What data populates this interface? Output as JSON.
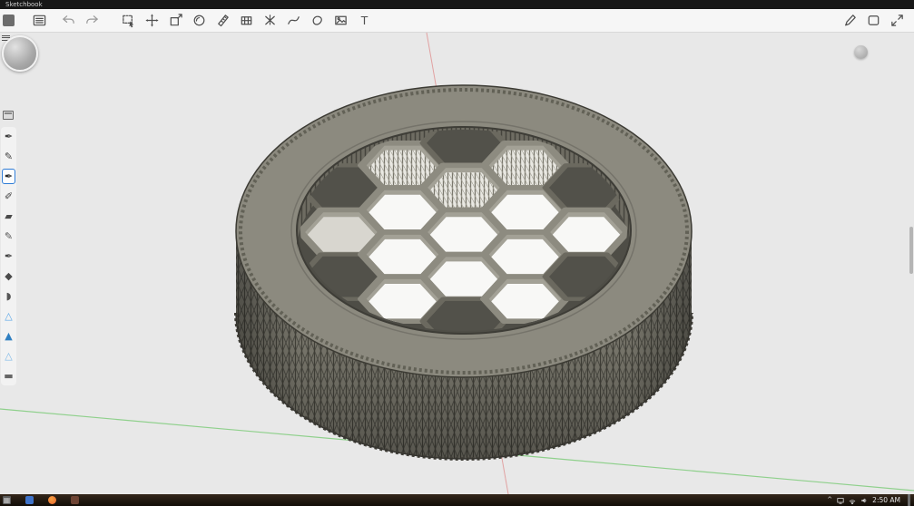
{
  "window": {
    "title": "Sketchbook"
  },
  "toolbar": {
    "left_icons": [
      "app-menu",
      "menu-list",
      "undo",
      "redo",
      "marquee-select",
      "move-transform",
      "distort",
      "fill-circle",
      "ruler",
      "perspective-grid",
      "symmetry",
      "stroke-curve",
      "lasso-shape",
      "import-image",
      "text-tool"
    ],
    "right_icons": [
      "stylus-edit",
      "layer-panel",
      "fullscreen"
    ],
    "text_glyph": "T"
  },
  "brushes": {
    "selected_index": 2,
    "items": [
      {
        "name": "ink-bottle",
        "glyph": "✒",
        "color": "#3f3f3f"
      },
      {
        "name": "pencil",
        "glyph": "✎",
        "color": "#3f3f3f"
      },
      {
        "name": "inking-pen",
        "glyph": "✒",
        "color": "#2b2b2b"
      },
      {
        "name": "ballpoint",
        "glyph": "✐",
        "color": "#3f3f3f"
      },
      {
        "name": "chisel-marker",
        "glyph": "▰",
        "color": "#4a4a4a"
      },
      {
        "name": "sketch-pencil",
        "glyph": "✎",
        "color": "#555555"
      },
      {
        "name": "paint-pen",
        "glyph": "✒",
        "color": "#454545"
      },
      {
        "name": "airbrush",
        "glyph": "◆",
        "color": "#4a4a4a"
      },
      {
        "name": "smudge",
        "glyph": "◗",
        "color": "#555555"
      },
      {
        "name": "watercolor-light",
        "glyph": "△",
        "color": "#5aa7e8"
      },
      {
        "name": "watercolor-solid",
        "glyph": "▲",
        "color": "#2f7fc1"
      },
      {
        "name": "watercolor-wash",
        "glyph": "△",
        "color": "#7db9e8"
      },
      {
        "name": "flat-eraser",
        "glyph": "▬",
        "color": "#666666"
      }
    ]
  },
  "canvas": {
    "background": "#e8e8e8",
    "axes": {
      "green": "#8fd08c",
      "red": "#e09090"
    }
  },
  "model": {
    "description": "3D render of a knurled cylindrical part with hexagonal honeycomb lattice top",
    "colors": {
      "top_face": "#8c8a7f",
      "side": "#7c7a6f",
      "knurl_dark": "#4a4941",
      "recess_floor": "#4e4d46",
      "hex_wall": "#8d8b80",
      "through_hole": "#f8f8f6"
    }
  },
  "taskbar": {
    "time": "2:50 AM",
    "app_icons": [
      "start",
      "browser-blue",
      "firefox",
      "app-dark"
    ],
    "tray_icons": [
      "chevron-up",
      "display",
      "network",
      "volume"
    ]
  }
}
